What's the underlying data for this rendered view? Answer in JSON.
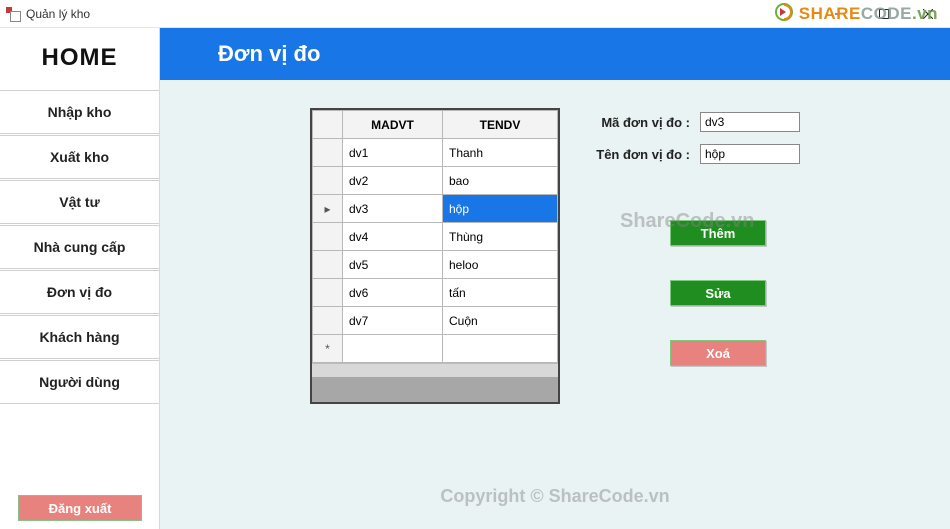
{
  "window": {
    "title": "Quản lý kho"
  },
  "sidebar": {
    "home": "HOME",
    "items": [
      "Nhập kho",
      "Xuất kho",
      "Vật tư",
      "Nhà cung cấp",
      "Đơn vị đo",
      "Khách hàng",
      "Người dùng"
    ],
    "logout": "Đăng xuất"
  },
  "page": {
    "title": "Đơn vị đo"
  },
  "grid": {
    "columns": [
      "MADVT",
      "TENDV"
    ],
    "rows": [
      {
        "madvt": "dv1",
        "tendv": "Thanh"
      },
      {
        "madvt": "dv2",
        "tendv": "bao"
      },
      {
        "madvt": "dv3",
        "tendv": "hộp"
      },
      {
        "madvt": "dv4",
        "tendv": "Thùng"
      },
      {
        "madvt": "dv5",
        "tendv": "heloo"
      },
      {
        "madvt": "dv6",
        "tendv": "tấn"
      },
      {
        "madvt": "dv7",
        "tendv": "Cuộn"
      }
    ],
    "selected_index": 2,
    "new_row_marker": "*"
  },
  "form": {
    "label_ma": "Mã đơn vị đo :",
    "value_ma": "dv3",
    "label_ten": "Tên đơn vị đo :",
    "value_ten": "hộp"
  },
  "buttons": {
    "them": "Thêm",
    "sua": "Sửa",
    "xoa": "Xoá"
  },
  "watermark": {
    "logo_prefix": "SHARE",
    "logo_suffix": "CODE",
    "logo_tld": ".vn",
    "center": "ShareCode.vn",
    "bottom": "Copyright © ShareCode.vn"
  }
}
